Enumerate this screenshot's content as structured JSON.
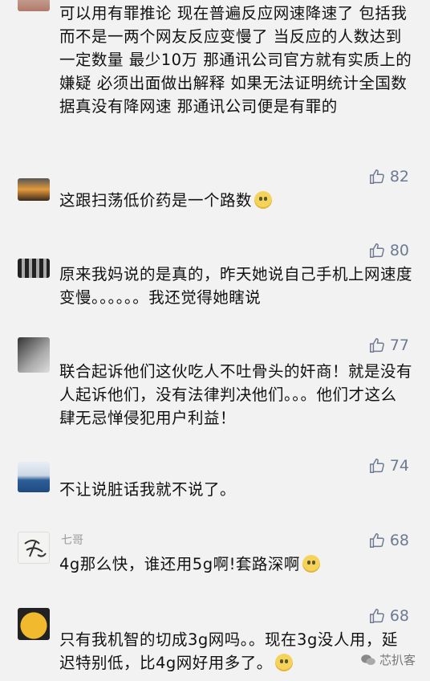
{
  "comments": [
    {
      "name": "",
      "avatar_icon": "user-avatar-photo",
      "likes": "",
      "text": "可以用有罪推论 现在普遍反应网速降速了 包括我 而不是一两个网友反应变慢了 当反应的人数达到一定数量 最少10万 那通讯公司官方就有实质上的嫌疑 必须出面做出解释 如果无法证明统计全国数据真没有降网速 那通讯公司便是有罪的"
    },
    {
      "name": "",
      "avatar_icon": "sunset-photo-avatar",
      "likes": "82",
      "text": "这跟扫荡低价药是一个路数",
      "emoji": "shocked-emoji-icon"
    },
    {
      "name": "",
      "avatar_icon": "dark-photo-avatar",
      "likes": "80",
      "text": "原来我妈说的是真的，昨天她说自己手机上网速度变慢。。。。。。我还觉得她瞎说"
    },
    {
      "name": "",
      "avatar_icon": "gray-photo-avatar",
      "likes": "77",
      "text": "联合起诉他们这伙吃人不吐骨头的奸商！就是没有人起诉他们，没有法律判决他们。。。他们才这么肆无忌惮侵犯用户利益！"
    },
    {
      "name": "",
      "avatar_icon": "blue-sea-avatar",
      "likes": "74",
      "text": "不让说脏话我就不说了。"
    },
    {
      "name": "七哥",
      "avatar_icon": "calligraphy-avatar",
      "likes": "68",
      "text": "4g那么快，谁还用5g啊!套路深啊",
      "emoji": "sweat-smile-emoji-icon"
    },
    {
      "name": "",
      "avatar_icon": "cartoon-avatar",
      "likes": "68",
      "text": "只有我机智的切成3g网吗。。现在3g没人用，延迟特别低，比4g网好用多了。",
      "emoji": "grin-emoji-icon"
    }
  ],
  "watermark": {
    "text": "芯扒客",
    "icon": "wechat-icon"
  },
  "colors": {
    "background": "#f2f2f2",
    "like": "#6d7a91",
    "text": "#111111"
  }
}
